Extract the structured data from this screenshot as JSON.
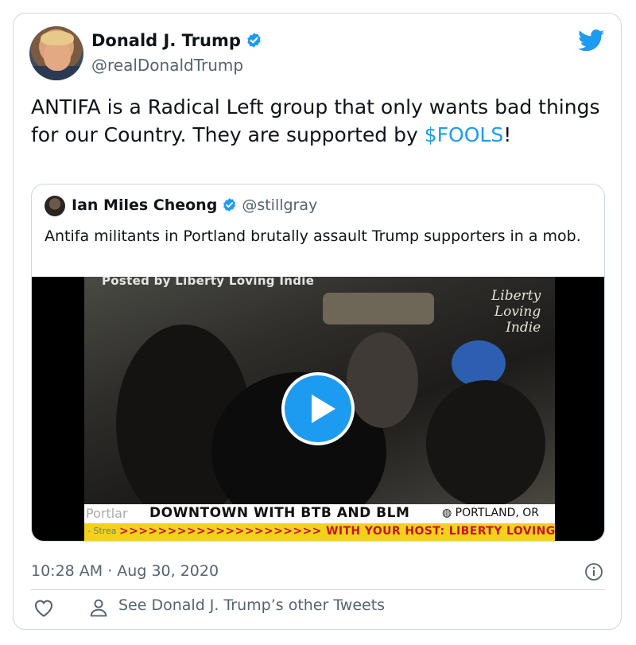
{
  "tweet": {
    "author_name": "Donald J. Trump",
    "author_handle": "@realDonaldTrump",
    "text_part1": "ANTIFA is a Radical Left group that only wants bad things for our Country. They are supported by ",
    "cashtag": "$FOOLS",
    "text_part2": "!",
    "timestamp": "10:28 AM · Aug 30, 2020",
    "other_tweets_label": "See Donald J. Trump’s other Tweets"
  },
  "quoted": {
    "author_name": "Ian Miles Cheong",
    "author_handle": "@stillgray",
    "text": "Antifa militants in Portland brutally assault Trump supporters in a mob.",
    "video": {
      "posted_by": "Posted by Liberty Loving Indie",
      "watermark_line1": "Liberty",
      "watermark_line2": "Loving",
      "watermark_line3": "Indie",
      "lower_third_left": "Portlar",
      "lower_third_title": "DOWNTOWN WITH BTB AND BLM",
      "lower_third_location": "PORTLAND, OR",
      "ticker_left": "- Strea",
      "ticker_text": ">>>>>>>>>>>>>>>>>>>>> WITH YOUR HOST: LIBERTY LOVING INDIE <<<"
    }
  },
  "colors": {
    "brand": "#1d9bf0",
    "text": "#0f1419",
    "secondary": "#536471",
    "border": "#cfd9de"
  },
  "icons": [
    "verified-badge-icon",
    "twitter-bird-icon",
    "play-icon",
    "info-icon",
    "heart-icon",
    "user-icon"
  ]
}
